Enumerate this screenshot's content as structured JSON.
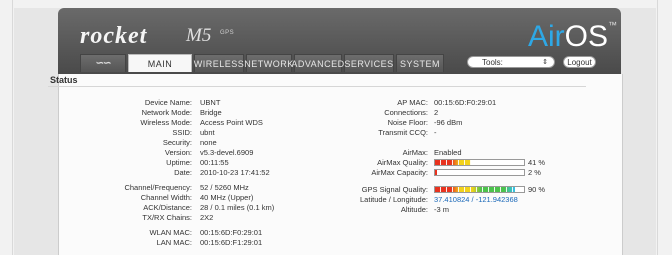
{
  "header": {
    "brand": "rocket",
    "model": "M5",
    "model_suffix": "GPS",
    "os_air": "Air",
    "os_name": "OS",
    "os_tm": "™"
  },
  "tabs": [
    {
      "label": "",
      "icon": "ubiquiti-logo-icon",
      "active": false
    },
    {
      "label": "MAIN",
      "active": true
    },
    {
      "label": "WIRELESS",
      "active": false
    },
    {
      "label": "NETWORK",
      "active": false
    },
    {
      "label": "ADVANCED",
      "active": false
    },
    {
      "label": "SERVICES",
      "active": false
    },
    {
      "label": "SYSTEM",
      "active": false
    }
  ],
  "toolbar": {
    "tools_label": "Tools:",
    "logout_label": "Logout"
  },
  "status": {
    "title": "Status",
    "left": [
      {
        "label": "Device Name:",
        "value": "UBNT"
      },
      {
        "label": "Network Mode:",
        "value": "Bridge"
      },
      {
        "label": "Wireless Mode:",
        "value": "Access Point WDS"
      },
      {
        "label": "SSID:",
        "value": "ubnt"
      },
      {
        "label": "Security:",
        "value": "none"
      },
      {
        "label": "Version:",
        "value": "v5.3-devel.6909"
      },
      {
        "label": "Uptime:",
        "value": "00:11:55"
      },
      {
        "label": "Date:",
        "value": "2010-10-23 17:41:52"
      },
      {
        "label": "Channel/Frequency:",
        "value": "52 / 5260 MHz"
      },
      {
        "label": "Channel Width:",
        "value": "40 MHz (Upper)"
      },
      {
        "label": "ACK/Distance:",
        "value": "28 / 0.1 miles (0.1 km)"
      },
      {
        "label": "TX/RX Chains:",
        "value": "2X2"
      },
      {
        "label": "WLAN MAC:",
        "value": "00:15:6D:F0:29:01"
      },
      {
        "label": "LAN MAC:",
        "value": "00:15:6D:F1:29:01"
      }
    ],
    "right": [
      {
        "label": "AP MAC:",
        "value": "00:15:6D:F0:29:01"
      },
      {
        "label": "Connections:",
        "value": "2"
      },
      {
        "label": "Noise Floor:",
        "value": "-96 dBm"
      },
      {
        "label": "Transmit CCQ:",
        "value": "-"
      },
      {
        "label": "AirMax:",
        "value": "Enabled"
      },
      {
        "label": "AirMax Quality:",
        "value": "41 %",
        "level": 0.41
      },
      {
        "label": "AirMax Capacity:",
        "value": "2 %",
        "level": 0.02
      },
      {
        "label": "GPS Signal Quality:",
        "value": "90 %",
        "level": 0.9
      },
      {
        "label": "Latitude / Longitude:",
        "value": "37.410824 / -121.942368"
      },
      {
        "label": "Altitude:",
        "value": "-3 m"
      }
    ]
  },
  "colors": {
    "accent": "#2ea8e6",
    "link": "#1a68b8",
    "bar_red": "#e8321e",
    "bar_yellow": "#f2d21a",
    "bar_green": "#4cc24c",
    "bar_cyan": "#38c0e0"
  }
}
